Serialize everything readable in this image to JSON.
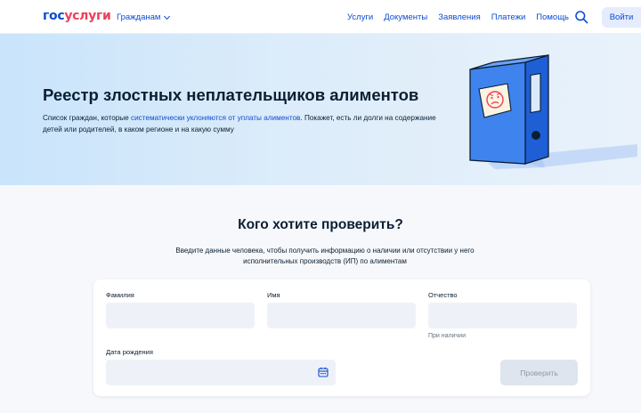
{
  "header": {
    "logo_part1": "гос",
    "logo_part2": "услуги",
    "audience": "Гражданам",
    "nav": [
      "Услуги",
      "Документы",
      "Заявления",
      "Платежи",
      "Помощь"
    ],
    "search_icon": "search-icon",
    "login": "Войти"
  },
  "hero": {
    "title": "Реестр злостных неплательщиков алиментов",
    "desc_before": "Список граждан, которые ",
    "desc_link": "систематически уклоняются от уплаты алиментов",
    "desc_after": ". Покажет, есть ли долги на содержание детей или родителей, в каком регионе и на какую сумму"
  },
  "check": {
    "title": "Кого хотите проверить?",
    "desc": "Введите данные человека, чтобы получить информацию о наличии или отсутствии у него исполнительных производств (ИП) по алиментам"
  },
  "form": {
    "surname_label": "Фамилия",
    "surname_value": "",
    "name_label": "Имя",
    "name_value": "",
    "patronymic_label": "Отчество",
    "patronymic_value": "",
    "patronymic_hint": "При наличии",
    "birthdate_label": "Дата рождения",
    "birthdate_value": "",
    "calendar_icon": "calendar-icon",
    "submit": "Проверить"
  },
  "colors": {
    "brand_blue": "#0d4cd3",
    "brand_red": "#ee3f58",
    "text": "#0b1f33",
    "field_bg": "#eef2f8",
    "button_disabled_bg": "#dfe5ee"
  }
}
